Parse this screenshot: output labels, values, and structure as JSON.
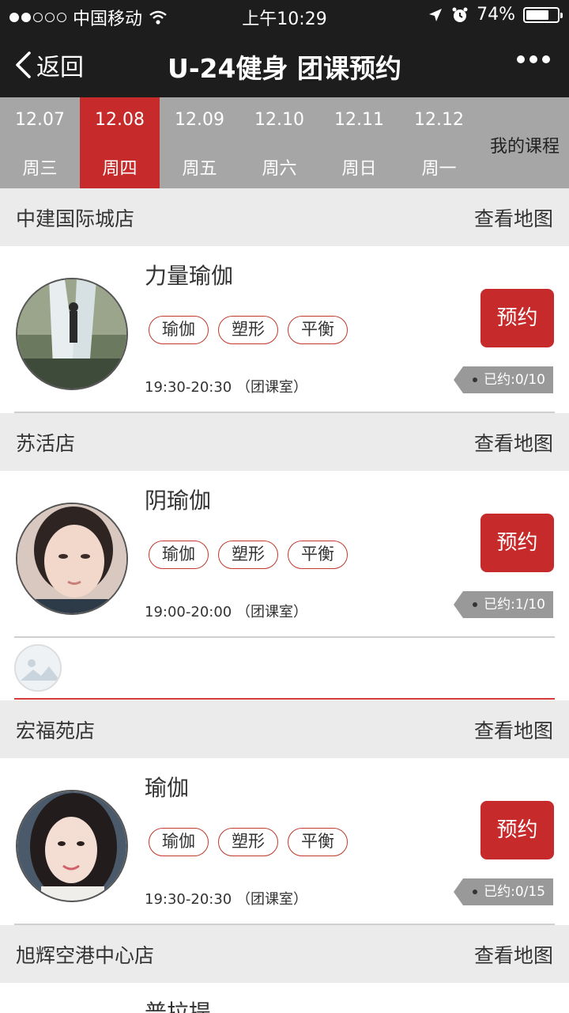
{
  "status_bar": {
    "carrier": "中国移动",
    "time": "上午10:29",
    "battery": "74%",
    "battery_level": 0.74,
    "signal_bars_filled": 2
  },
  "nav": {
    "back_label": "返回",
    "title": "U-24健身 团课预约"
  },
  "dates": [
    {
      "date": "12.07",
      "weekday": "周三"
    },
    {
      "date": "12.08",
      "weekday": "周四",
      "active": true
    },
    {
      "date": "12.09",
      "weekday": "周五"
    },
    {
      "date": "12.10",
      "weekday": "周六"
    },
    {
      "date": "12.11",
      "weekday": "周日"
    },
    {
      "date": "12.12",
      "weekday": "周一"
    }
  ],
  "my_courses_label": "我的课程",
  "map_label": "查看地图",
  "book_label": "预约",
  "sections": [
    {
      "store": "中建国际城店",
      "course": {
        "name": "力量瑜伽",
        "tags": [
          "瑜伽",
          "塑形",
          "平衡"
        ],
        "time": "19:30-20:30 （团课室）",
        "quota": "已约:0/10"
      }
    },
    {
      "store": "苏活店",
      "course": {
        "name": "阴瑜伽",
        "tags": [
          "瑜伽",
          "塑形",
          "平衡"
        ],
        "time": "19:00-20:00 （团课室）",
        "quota": "已约:1/10"
      }
    },
    {
      "store": "宏福苑店",
      "course": {
        "name": "瑜伽",
        "tags": [
          "瑜伽",
          "塑形",
          "平衡"
        ],
        "time": "19:30-20:30 （团课室）",
        "quota": "已约:0/15"
      }
    },
    {
      "store": "旭辉空港中心店",
      "course": {
        "name": "普拉提"
      }
    }
  ],
  "colors": {
    "accent": "#c62a2a",
    "nav_bg": "#1d1d1d",
    "date_bar": "#a6a6a6",
    "section_bg": "#ebebeb"
  }
}
